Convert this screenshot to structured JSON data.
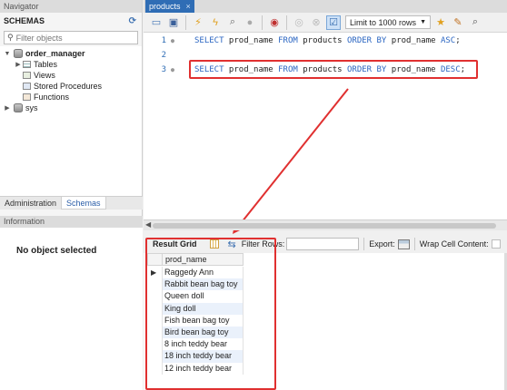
{
  "navigator": {
    "title": "Navigator",
    "schemas_label": "SCHEMAS",
    "filter_placeholder": "Filter objects",
    "tree": [
      {
        "label": "order_manager",
        "icon": "database-icon",
        "expanded": true
      },
      {
        "label": "Tables",
        "icon": "tables-icon"
      },
      {
        "label": "Views",
        "icon": "views-icon"
      },
      {
        "label": "Stored Procedures",
        "icon": "stored-procedures-icon"
      },
      {
        "label": "Functions",
        "icon": "functions-icon"
      },
      {
        "label": "sys",
        "icon": "database-icon",
        "expanded": false
      }
    ],
    "tabs": [
      "Administration",
      "Schemas"
    ],
    "active_tab": "Schemas",
    "info_title": "Information",
    "info_text": "No object selected"
  },
  "query_tab": {
    "label": "products",
    "close": "×"
  },
  "toolbar": {
    "limit_label": "Limit to 1000 rows"
  },
  "editor": {
    "lines": [
      {
        "num": "1",
        "tokens": [
          [
            "SELECT",
            "kw"
          ],
          [
            " prod_name ",
            "id"
          ],
          [
            "FROM",
            "kw"
          ],
          [
            " products ",
            "id"
          ],
          [
            "ORDER BY",
            "kw"
          ],
          [
            " prod_name ",
            "id"
          ],
          [
            "ASC",
            "kw"
          ],
          [
            ";",
            "id"
          ]
        ]
      },
      {
        "num": "2",
        "tokens": []
      },
      {
        "num": "3",
        "tokens": [
          [
            "SELECT",
            "kw"
          ],
          [
            " prod_name ",
            "id"
          ],
          [
            "FROM",
            "kw"
          ],
          [
            " products ",
            "id"
          ],
          [
            "ORDER BY",
            "kw"
          ],
          [
            " prod_name ",
            "id"
          ],
          [
            "DESC",
            "kw"
          ],
          [
            ";",
            "id"
          ]
        ]
      }
    ],
    "highlight_color": "#e03030"
  },
  "result_toolbar": {
    "result_grid_label": "Result Grid",
    "filter_rows_label": "Filter Rows:",
    "export_label": "Export:",
    "wrap_label": "Wrap Cell Content:"
  },
  "result_grid": {
    "column": "prod_name",
    "rows": [
      "Raggedy Ann",
      "Rabbit bean bag toy",
      "Queen doll",
      "King doll",
      "Fish bean bag toy",
      "Bird bean bag toy",
      "8 inch teddy bear",
      "18 inch teddy bear",
      "12 inch teddy bear"
    ]
  }
}
